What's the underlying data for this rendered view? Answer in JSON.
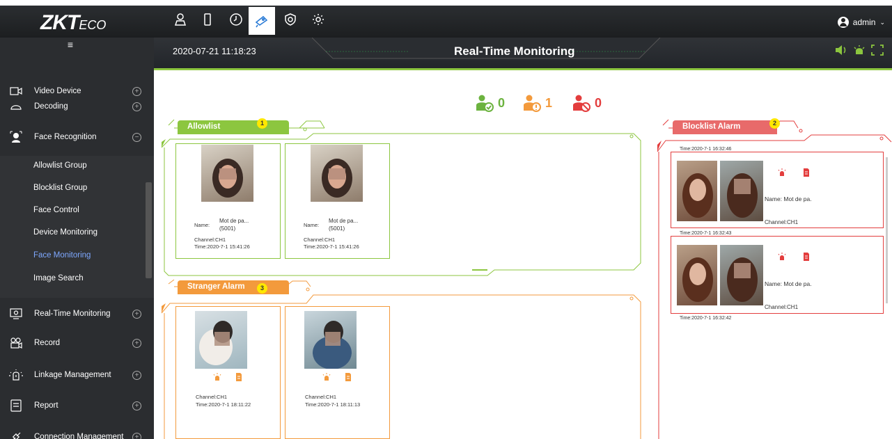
{
  "app": {
    "logo_main": "ZKT",
    "logo_sub": "ECO",
    "user": "admin",
    "datetime": "2020-07-21 11:18:23",
    "title": "Real-Time Monitoring"
  },
  "colors": {
    "accent_green": "#8cc63f",
    "accent_orange": "#f39a3c",
    "accent_red": "#e33d3d",
    "sidebar_bg": "#2b2d30",
    "active_link": "#7ea8ff"
  },
  "topnav": [
    {
      "icon": "person-icon"
    },
    {
      "icon": "device-icon"
    },
    {
      "icon": "clock-icon"
    },
    {
      "icon": "camera-icon"
    },
    {
      "icon": "shield-icon"
    },
    {
      "icon": "gear-icon"
    }
  ],
  "sidebar": {
    "items": [
      {
        "label": "Video Device",
        "icon": "video-device-icon"
      },
      {
        "label": "Decoding",
        "icon": "decoding-icon"
      },
      {
        "label": "Face Recognition",
        "icon": "face-recognition-icon"
      },
      {
        "label": "Real-Time Monitoring",
        "icon": "monitor-icon"
      },
      {
        "label": "Record",
        "icon": "record-icon"
      },
      {
        "label": "Linkage Management",
        "icon": "linkage-icon"
      },
      {
        "label": "Report",
        "icon": "report-icon"
      },
      {
        "label": "Connection Management",
        "icon": "connection-icon"
      }
    ],
    "sub_items": [
      {
        "label": "Allowlist Group"
      },
      {
        "label": "Blocklist Group"
      },
      {
        "label": "Face Control"
      },
      {
        "label": "Device Monitoring"
      },
      {
        "label": "Face Monitoring"
      },
      {
        "label": "Image Search"
      }
    ]
  },
  "stats": {
    "allowed": "0",
    "stranger": "1",
    "blocked": "0"
  },
  "allowlist": {
    "tab": "Allowlist",
    "badge": "1",
    "cards": [
      {
        "name_label": "Name:",
        "name": "Mot de pa...",
        "id": "(5001)",
        "channel": "Channel:CH1",
        "time": "Time:2020-7-1 15:41:26"
      },
      {
        "name_label": "Name:",
        "name": "Mot de pa...",
        "id": "(5001)",
        "channel": "Channel:CH1",
        "time": "Time:2020-7-1 15:41:26"
      }
    ]
  },
  "stranger": {
    "tab": "Stranger Alarm",
    "badge": "3",
    "cards": [
      {
        "channel": "Channel:CH1",
        "time": "Time:2020-7-1 18:11:22"
      },
      {
        "channel": "Channel:CH1",
        "time": "Time:2020-7-1 18:11:13"
      }
    ]
  },
  "blocklist": {
    "tab": "Blocklist Alarm",
    "badge": "2",
    "top_time": "Time:2020-7-1 16:32:46",
    "cards": [
      {
        "name": "Name:  Mot de pa.",
        "channel": "Channel:CH1",
        "time": "Time:2020-7-1 16:32:43"
      },
      {
        "name": "Name:  Mot de pa.",
        "channel": "Channel:CH1",
        "time": "Time:2020-7-1 16:32:42"
      }
    ]
  }
}
